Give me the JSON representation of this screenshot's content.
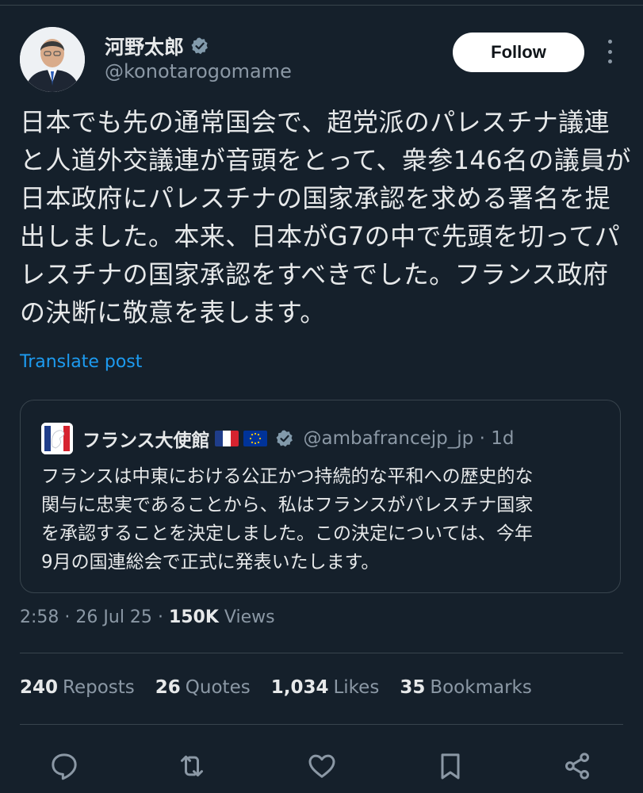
{
  "author": {
    "name": "河野太郎",
    "handle": "@konotarogomame"
  },
  "follow_label": "Follow",
  "tweet": {
    "lines": [
      "日本でも先の通常国会で、超党派のパレスチナ議連",
      "と人道外交議連が音頭をとって、衆参146名の議員が",
      "日本政府にパレスチナの国家承認を求める署名を提",
      "出しました。本来、日本がG7の中で先頭を切ってパ",
      "レスチナの国家承認をすべきでした。フランス政府",
      "の決断に敬意を表します。"
    ],
    "translate_label": "Translate post"
  },
  "quote": {
    "name": "フランス大使館",
    "handle": "@ambafrancejp_jp",
    "separator": "·",
    "time": "1d",
    "lines": [
      "フランスは中東における公正かつ持続的な平和への歴史的な",
      "関与に忠実であることから、私はフランスがパレスチナ国家",
      "を承認することを決定しました。この決定については、今年",
      "9月の国連総会で正式に発表いたします。"
    ]
  },
  "meta": {
    "time": "2:58",
    "sep1": "·",
    "date": "26 Jul 25",
    "sep2": "·",
    "views_count": "150K",
    "views_label": "Views"
  },
  "stats": [
    {
      "count": "240",
      "label": "Reposts"
    },
    {
      "count": "26",
      "label": "Quotes"
    },
    {
      "count": "1,034",
      "label": "Likes"
    },
    {
      "count": "35",
      "label": "Bookmarks"
    }
  ],
  "icons": {
    "reply": "reply-icon",
    "repost": "repost-icon",
    "like": "heart-icon",
    "bookmark": "bookmark-icon",
    "share": "share-icon"
  },
  "colors": {
    "background": "#15202b",
    "accent": "#1d9bf0",
    "muted": "#8b98a5",
    "border": "#38444d"
  }
}
